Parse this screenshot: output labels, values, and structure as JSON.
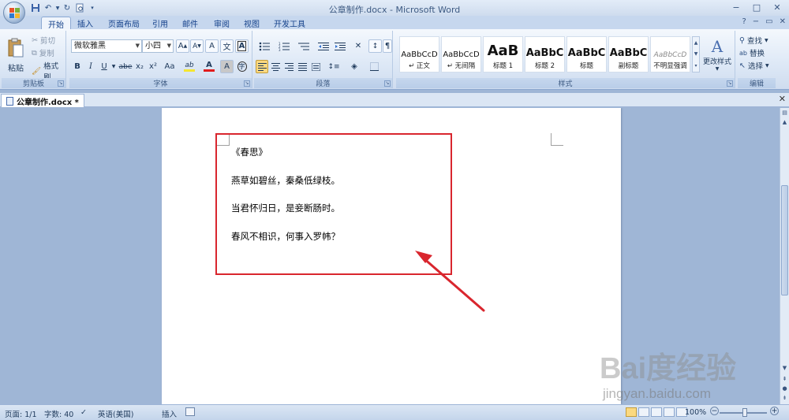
{
  "window": {
    "title": "公章制作.docx - Microsoft Word",
    "controls": [
      "−",
      "□",
      "✕"
    ]
  },
  "qat": {
    "icons": [
      "save-icon",
      "undo-icon",
      "redo-icon",
      "print-preview-icon",
      "customize-icon"
    ]
  },
  "ribbon_tabs": [
    "开始",
    "插入",
    "页面布局",
    "引用",
    "邮件",
    "审阅",
    "视图",
    "开发工具"
  ],
  "clipboard": {
    "paste_label": "粘贴",
    "cut_label": "剪切",
    "copy_label": "复制",
    "format_painter_label": "格式刷",
    "group_label": "剪贴板"
  },
  "font": {
    "font_name": "微软雅黑",
    "font_size": "小四",
    "grow": "A",
    "shrink": "A",
    "clear": "A",
    "phonetic": "文",
    "border_char": "A",
    "bold": "B",
    "italic": "I",
    "underline": "U",
    "strike": "abe",
    "subscript": "x₂",
    "superscript": "x²",
    "change_case": "Aa",
    "highlight": "ab",
    "font_color": "A",
    "char_shade": "A",
    "enclose": "字",
    "group_label": "字体"
  },
  "paragraph": {
    "group_label": "段落"
  },
  "styles": {
    "items": [
      {
        "sample": "AaBbCcD",
        "name": "↵ 正文"
      },
      {
        "sample": "AaBbCcD",
        "name": "↵ 无间隔"
      },
      {
        "sample": "AaB",
        "name": "标题 1"
      },
      {
        "sample": "AaBbC",
        "name": "标题 2"
      },
      {
        "sample": "AaBbC",
        "name": "标题"
      },
      {
        "sample": "AaBbC",
        "name": "副标题"
      },
      {
        "sample": "AaBbCcD",
        "name": "不明显强调"
      }
    ],
    "change_styles_label": "更改样式",
    "group_label": "样式"
  },
  "editing": {
    "find_label": "查找",
    "replace_label": "替换",
    "select_label": "选择",
    "group_label": "编辑"
  },
  "document_tab": {
    "label": "公章制作.docx *"
  },
  "document": {
    "lines": [
      "《春思》",
      "燕草如碧丝，秦桑低绿枝。",
      "当君怀归日，是妾断肠时。",
      "春风不相识，何事入罗帏？"
    ]
  },
  "annotation": {
    "box_color": "#d9262e",
    "arrow_color": "#d9262e"
  },
  "statusbar": {
    "page": "页面: 1/1",
    "words": "字数: 40",
    "language": "英语(美国)",
    "insert_mode": "插入",
    "zoom": "100%"
  },
  "watermark": {
    "logo": "Bai度经验",
    "url": "jingyan.baidu.com"
  }
}
